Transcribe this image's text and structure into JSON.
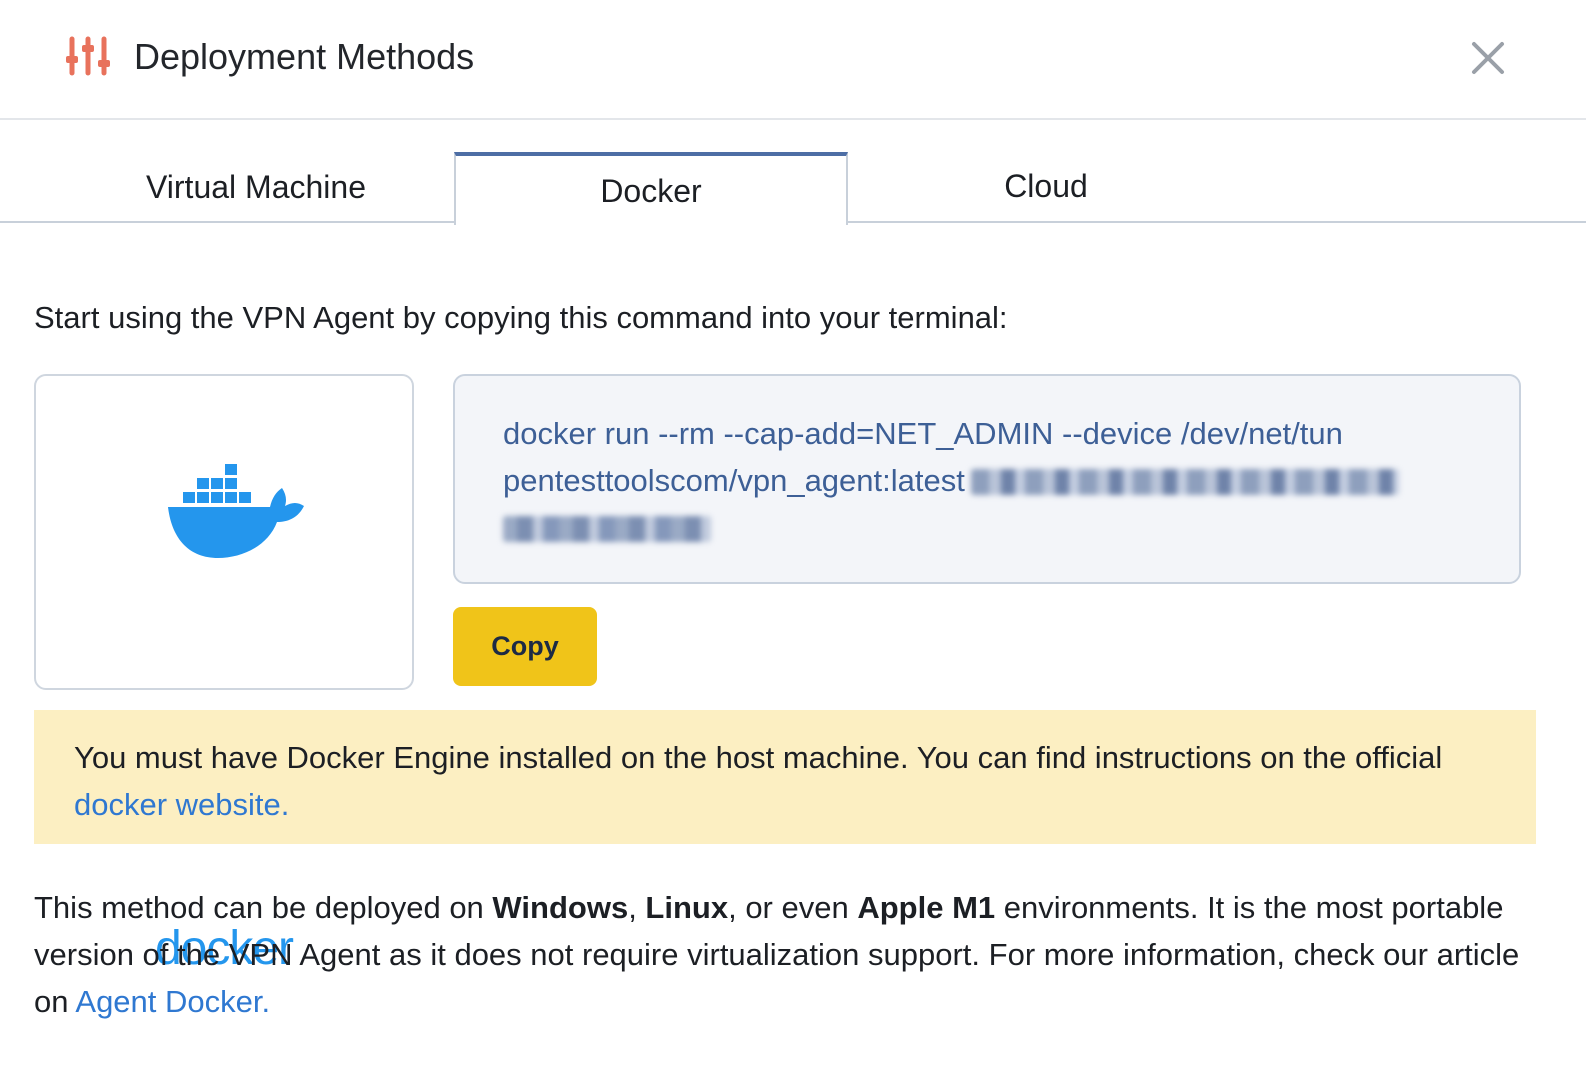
{
  "header": {
    "title": "Deployment Methods",
    "icon": "sliders-icon",
    "accent_color": "#e8725c",
    "close_icon": "close-icon"
  },
  "tabs": [
    {
      "label": "Virtual Machine",
      "active": false
    },
    {
      "label": "Docker",
      "active": true
    },
    {
      "label": "Cloud",
      "active": false
    }
  ],
  "content": {
    "intro": "Start using the VPN Agent by copying this command into your terminal:",
    "logo": {
      "word": "docker",
      "color": "#2496ed"
    },
    "command": {
      "line1": "docker run --rm --cap-add=NET_ADMIN --device /dev/net/tun",
      "line2": "pentesttoolscom/vpn_agent:latest"
    },
    "copy_label": "Copy",
    "notice": {
      "text": "You must have Docker Engine installed on the host machine. You can find instructions on the official ",
      "link_text": "docker website."
    },
    "description": {
      "part1": "This method can be deployed on ",
      "bold1": "Windows",
      "part2": ", ",
      "bold2": "Linux",
      "part3": ", or even ",
      "bold3": "Apple M1",
      "part4": " environments. It is the most portable version of the VPN Agent as it does not require virtualization support. For more information, check our article on ",
      "link_text": "Agent Docker."
    }
  },
  "colors": {
    "tab_active_border": "#4d6ea5",
    "command_text": "#3d5f96",
    "copy_button": "#f0c419",
    "notice_bg": "#fcefc2",
    "link": "#2f78d1"
  }
}
